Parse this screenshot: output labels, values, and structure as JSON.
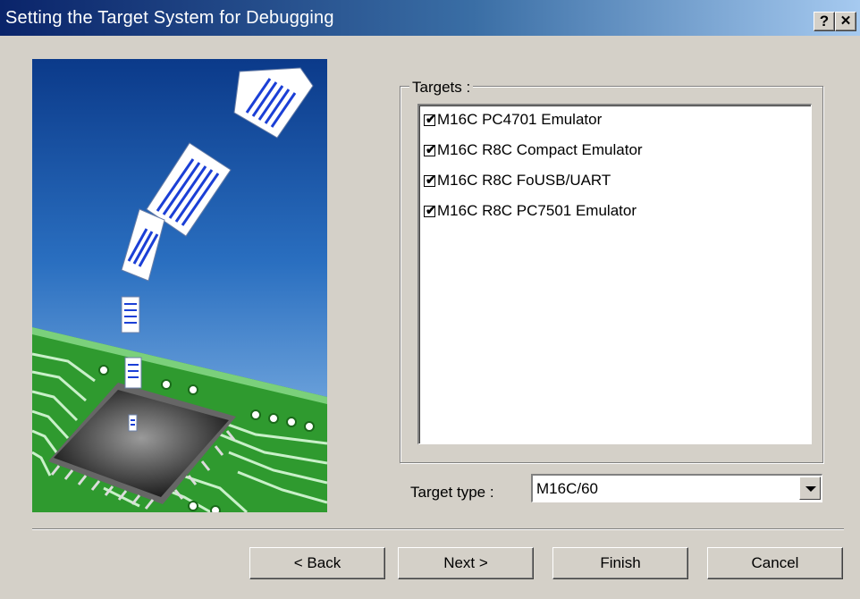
{
  "window": {
    "title": "Setting the Target System for Debugging",
    "help_label": "?",
    "close_label": "✕"
  },
  "targets": {
    "label": "Targets :",
    "items": [
      {
        "label": "M16C PC4701 Emulator",
        "checked": true
      },
      {
        "label": "M16C R8C Compact Emulator",
        "checked": true
      },
      {
        "label": "M16C R8C FoUSB/UART",
        "checked": true
      },
      {
        "label": "M16C R8C PC7501 Emulator",
        "checked": true
      }
    ]
  },
  "target_type": {
    "label": "Target type :",
    "value": "M16C/60"
  },
  "buttons": {
    "back": "< Back",
    "next": "Next >",
    "finish": "Finish",
    "cancel": "Cancel"
  },
  "checkmark": "✔",
  "colors": {
    "title_start": "#0a246a",
    "title_end": "#a6caf0",
    "dialog_bg": "#d4d0c8",
    "pcb_green": "#2f9a2f",
    "sky_blue": "#2a6fc0"
  }
}
